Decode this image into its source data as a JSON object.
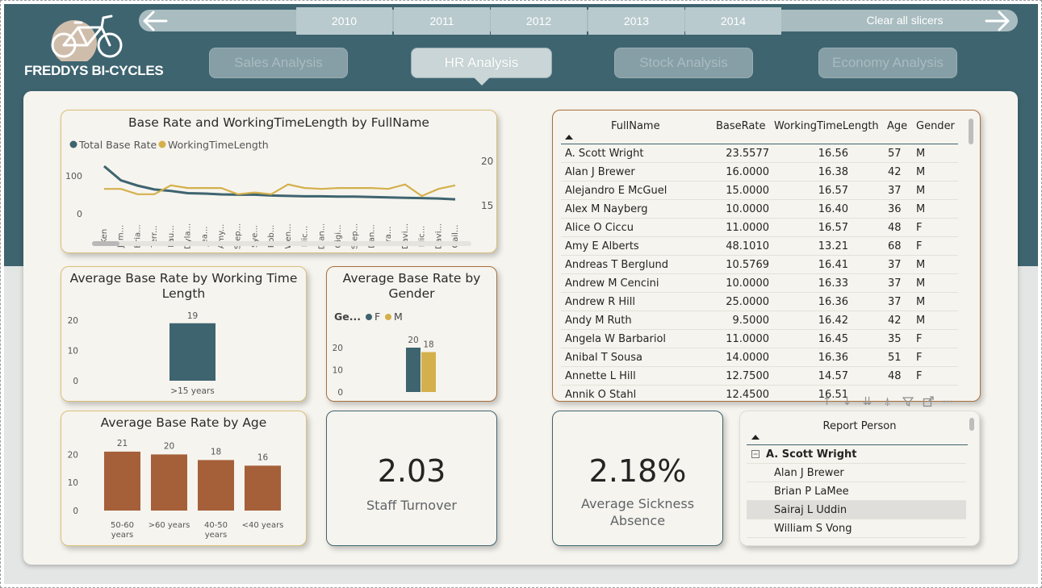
{
  "brand": {
    "name": "FREDDYS BI-CYCLES",
    "colors": {
      "teal": "#3e6470",
      "gold": "#d4b04c",
      "brown": "#a5603a"
    }
  },
  "slicer": {
    "years": [
      "2010",
      "2011",
      "2012",
      "2013",
      "2014"
    ],
    "clear_label": "Clear all slicers",
    "left_icon": "arrow-left-icon",
    "right_icon": "arrow-right-icon"
  },
  "nav": {
    "sales": "Sales Analysis",
    "hr": "HR Analysis",
    "stock": "Stock Analysis",
    "economy": "Economy Analysis",
    "active": "HR Analysis"
  },
  "line_chart": {
    "title": "Base Rate and WorkingTimeLength by FullName",
    "legend": [
      "Total Base Rate",
      "WorkingTimeLength"
    ]
  },
  "wtl_chart": {
    "title": "Average Base Rate by Working Time Length"
  },
  "gender_chart": {
    "title": "Average Base Rate by Gender",
    "legend_label": "Ge...",
    "legend": [
      "F",
      "M"
    ]
  },
  "age_chart": {
    "title": "Average Base Rate by Age"
  },
  "chart_data": [
    {
      "type": "line",
      "title": "Base Rate and WorkingTimeLength by FullName",
      "x": [
        "Ken",
        "Jam...",
        "Bria...",
        "Terr...",
        "Lau...",
        "Dyla...",
        "Jea...",
        "Amy...",
        "Step...",
        "Sye...",
        "Rob...",
        "Wen...",
        "Mic...",
        "Dian...",
        "Gigi...",
        "Step...",
        "Dan...",
        "Fra...",
        "Davi...",
        "Mic...",
        "Davi...",
        "Gail..."
      ],
      "y_left_ticks": [
        "100",
        "0"
      ],
      "y_right_ticks": [
        "20",
        "15"
      ],
      "series": [
        {
          "name": "Total Base Rate",
          "axis": "left",
          "values": [
            125,
            88,
            74,
            64,
            60,
            54,
            53,
            51,
            50,
            50,
            48,
            47,
            46,
            46,
            45,
            45,
            44,
            43,
            42,
            41,
            40,
            38
          ]
        },
        {
          "name": "WorkingTimeLength",
          "axis": "right",
          "values": [
            16.8,
            16.8,
            16.2,
            16.2,
            17.2,
            16.9,
            16.9,
            16.9,
            16.2,
            16.4,
            16.2,
            17.3,
            16.9,
            16.8,
            16.9,
            16.9,
            16.9,
            16.8,
            17.3,
            16.0,
            16.8,
            17.2
          ]
        }
      ],
      "ylim_left": [
        0,
        140
      ],
      "ylim_right": [
        14,
        20
      ]
    },
    {
      "type": "bar",
      "title": "Average Base Rate by Working Time Length",
      "categories": [
        ">15 years"
      ],
      "values": [
        19
      ],
      "y_ticks": [
        "20",
        "10",
        "0"
      ],
      "ylim": [
        0,
        20
      ]
    },
    {
      "type": "bar",
      "title": "Average Base Rate by Gender",
      "categories": [
        "F",
        "M"
      ],
      "series": [
        {
          "name": "F",
          "values": [
            20
          ]
        },
        {
          "name": "M",
          "values": [
            18
          ]
        }
      ],
      "y_ticks": [
        "20",
        "10",
        "0"
      ],
      "ylim": [
        0,
        20
      ]
    },
    {
      "type": "bar",
      "title": "Average Base Rate by Age",
      "categories": [
        "50-60 years",
        ">60 years",
        "40-50 years",
        "<40 years"
      ],
      "category_lines": [
        [
          "50-60",
          "years"
        ],
        [
          ">60 years"
        ],
        [
          "40-50",
          "years"
        ],
        [
          "<40 years"
        ]
      ],
      "values": [
        21,
        20,
        18,
        16
      ],
      "y_ticks": [
        "20",
        "10",
        "0"
      ],
      "ylim": [
        0,
        25
      ]
    }
  ],
  "table": {
    "headers": [
      "FullName",
      "BaseRate",
      "WorkingTimeLength",
      "Age",
      "Gender"
    ],
    "rows": [
      [
        "A. Scott Wright",
        "23.5577",
        "16.56",
        "57",
        "M"
      ],
      [
        "Alan J Brewer",
        "16.0000",
        "16.38",
        "42",
        "M"
      ],
      [
        "Alejandro E McGuel",
        "15.0000",
        "16.57",
        "37",
        "M"
      ],
      [
        "Alex M Nayberg",
        "10.0000",
        "16.40",
        "36",
        "M"
      ],
      [
        "Alice O Ciccu",
        "11.0000",
        "16.57",
        "48",
        "F"
      ],
      [
        "Amy E Alberts",
        "48.1010",
        "13.21",
        "68",
        "F"
      ],
      [
        "Andreas T Berglund",
        "10.5769",
        "16.41",
        "37",
        "M"
      ],
      [
        "Andrew M Cencini",
        "10.0000",
        "16.33",
        "37",
        "M"
      ],
      [
        "Andrew R Hill",
        "25.0000",
        "16.36",
        "37",
        "M"
      ],
      [
        "Andy M Ruth",
        "9.5000",
        "16.42",
        "42",
        "M"
      ],
      [
        "Angela W Barbariol",
        "11.0000",
        "16.45",
        "35",
        "F"
      ],
      [
        "Anibal T Sousa",
        "14.0000",
        "16.36",
        "51",
        "F"
      ],
      [
        "Annette L Hill",
        "12.7500",
        "14.57",
        "48",
        "F"
      ],
      [
        "Annik O Stahl",
        "12.4500",
        "16.51",
        "",
        ""
      ]
    ]
  },
  "kpis": {
    "turnover_value": "2.03",
    "turnover_label": "Staff Turnover",
    "sickness_value": "2.18%",
    "sickness_label_1": "Average Sickness",
    "sickness_label_2": "Absence"
  },
  "report_person": {
    "title": "Report Person",
    "root": "A. Scott Wright",
    "children": [
      "Alan J Brewer",
      "Brian P LaMee",
      "Sairaj L Uddin",
      "William S Vong"
    ],
    "selected": "Sairaj L Uddin"
  },
  "toolbar_icons": [
    "sort-up-icon",
    "sort-down-icon",
    "expand-all-icon",
    "drill-icon",
    "filter-icon",
    "focus-mode-icon",
    "more-options-icon"
  ]
}
